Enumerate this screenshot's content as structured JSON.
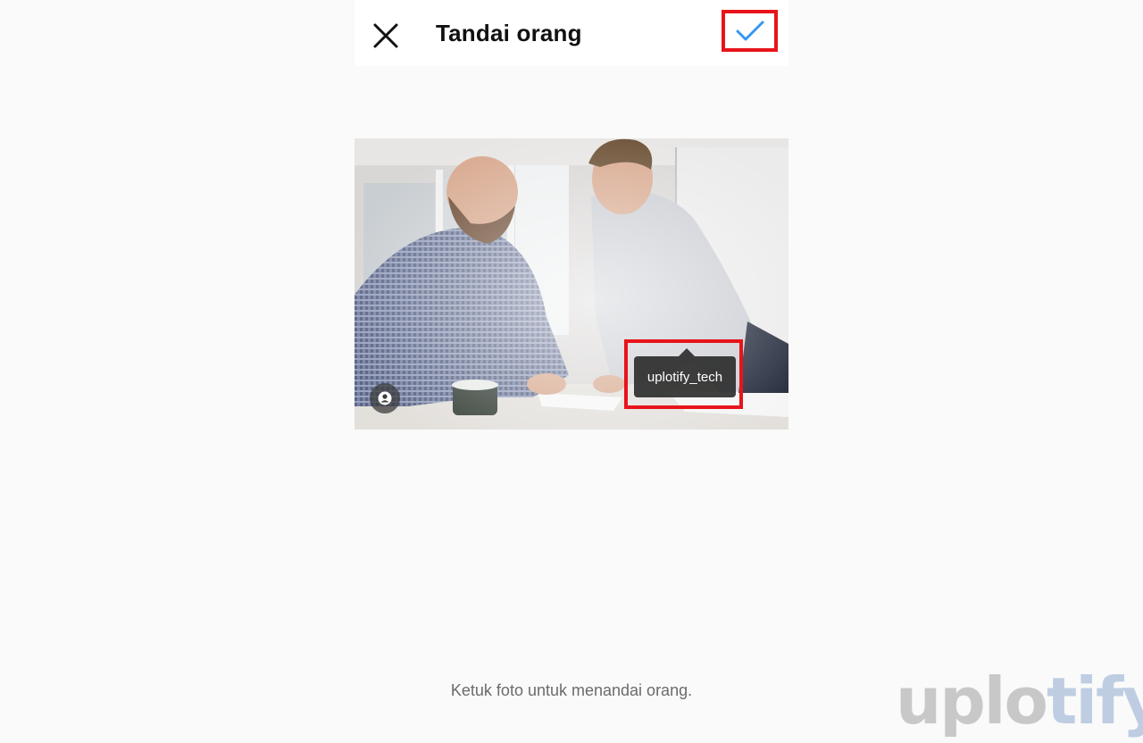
{
  "header": {
    "title": "Tandai orang",
    "close_icon": "close-icon",
    "done_icon": "checkmark-icon",
    "accent_color": "#3897f0",
    "highlight_color": "#e8141b"
  },
  "photo": {
    "tag_label": "uplotify_tech",
    "badge_icon": "user-icon"
  },
  "footer": {
    "hint": "Ketuk foto untuk menandai orang."
  },
  "watermark": {
    "part1": "uplo",
    "part2": "tify"
  }
}
